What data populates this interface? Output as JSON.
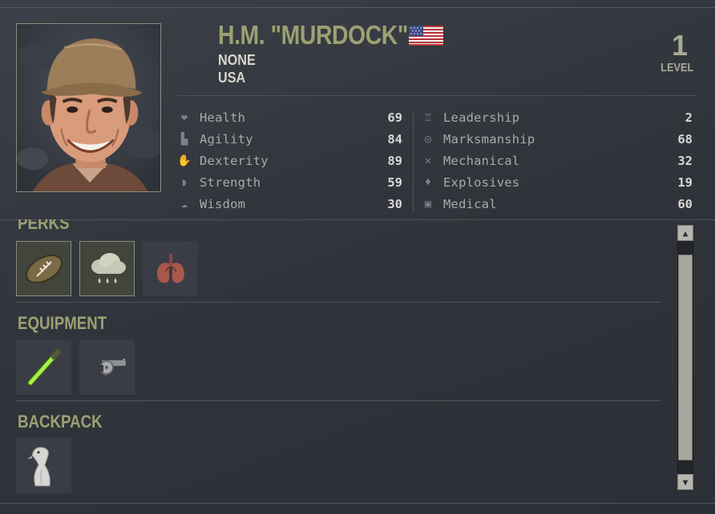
{
  "merc": {
    "name": "H.M. \"MURDOCK\"",
    "affiliation": "NONE",
    "nationality": "USA",
    "level": "1",
    "level_label": "LEVEL",
    "flag_icon": "usa-flag-icon",
    "portrait_icon": "mercenary-portrait"
  },
  "stats_left": [
    {
      "icon": "heart-icon",
      "label": "Health",
      "value": "69"
    },
    {
      "icon": "boot-icon",
      "label": "Agility",
      "value": "84"
    },
    {
      "icon": "hand-icon",
      "label": "Dexterity",
      "value": "89"
    },
    {
      "icon": "bicep-icon",
      "label": "Strength",
      "value": "59"
    },
    {
      "icon": "brain-icon",
      "label": "Wisdom",
      "value": "30"
    }
  ],
  "stats_right": [
    {
      "icon": "medal-icon",
      "label": "Leadership",
      "value": "2"
    },
    {
      "icon": "target-icon",
      "label": "Marksmanship",
      "value": "68"
    },
    {
      "icon": "wrench-icon",
      "label": "Mechanical",
      "value": "32"
    },
    {
      "icon": "grenade-icon",
      "label": "Explosives",
      "value": "19"
    },
    {
      "icon": "medkit-icon",
      "label": "Medical",
      "value": "60"
    }
  ],
  "sections": {
    "perks_title": "PERKS",
    "equipment_title": "EQUIPMENT",
    "backpack_title": "BACKPACK"
  },
  "perks": [
    {
      "icon": "football-icon"
    },
    {
      "icon": "rain-cloud-icon"
    },
    {
      "icon": "lungs-icon"
    }
  ],
  "equipment": [
    {
      "icon": "glowstick-icon"
    },
    {
      "icon": "revolver-icon"
    }
  ],
  "backpack": [
    {
      "icon": "rubber-chicken-icon"
    }
  ],
  "colors": {
    "accent": "#9ba172",
    "background": "#33363d",
    "text": "#c9c9c4"
  }
}
